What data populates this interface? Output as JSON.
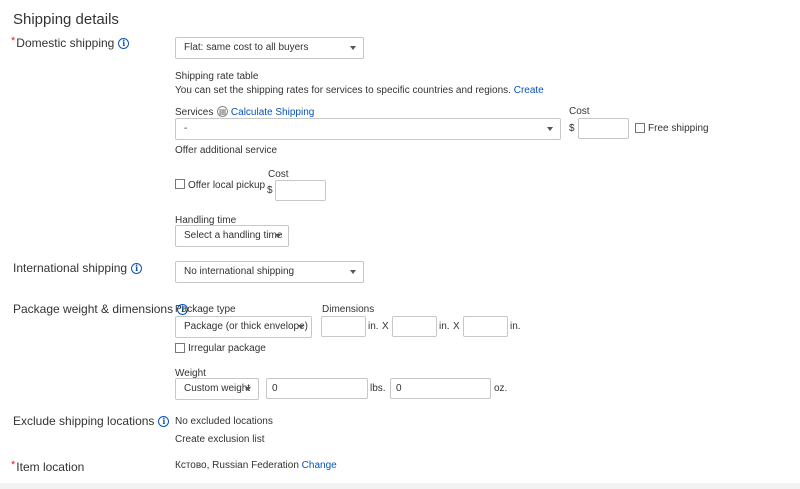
{
  "section_title": "Shipping details",
  "domestic": {
    "label": "Domestic shipping",
    "required_mark": "*",
    "select_value": "Flat: same cost to all buyers",
    "rate_table_title": "Shipping rate table",
    "rate_table_desc": "You can set the shipping rates for services to specific countries and regions.",
    "rate_table_link": "Create",
    "services_label": "Services",
    "calc_link": "Calculate Shipping",
    "service_value": "-",
    "cost_label": "Cost",
    "currency": "$",
    "free_shipping": "Free shipping",
    "offer_additional": "Offer additional service",
    "local_pickup": "Offer local pickup",
    "pickup_cost_label": "Cost",
    "pickup_currency": "$",
    "handling_label": "Handling time",
    "handling_value": "Select a handling time"
  },
  "international": {
    "label": "International shipping",
    "select_value": "No international shipping"
  },
  "package": {
    "label": "Package weight & dimensions",
    "type_label": "Package type",
    "type_value": "Package (or thick envelope)",
    "dimensions_label": "Dimensions",
    "unit_in": "in.",
    "x": "X",
    "irregular": "Irregular package",
    "weight_label": "Weight",
    "weight_select": "Custom weight",
    "lbs_value": "0",
    "lbs_unit": "lbs.",
    "oz_value": "0",
    "oz_unit": "oz."
  },
  "exclude": {
    "label": "Exclude shipping locations",
    "value": "No excluded locations",
    "link": "Create exclusion list"
  },
  "location": {
    "label": "Item location",
    "required_mark": "*",
    "value": "Кстово, Russian Federation",
    "link": "Change"
  },
  "colors": {
    "link": "#0654ba",
    "required": "#dd1e31",
    "border": "#c7c7c7"
  }
}
